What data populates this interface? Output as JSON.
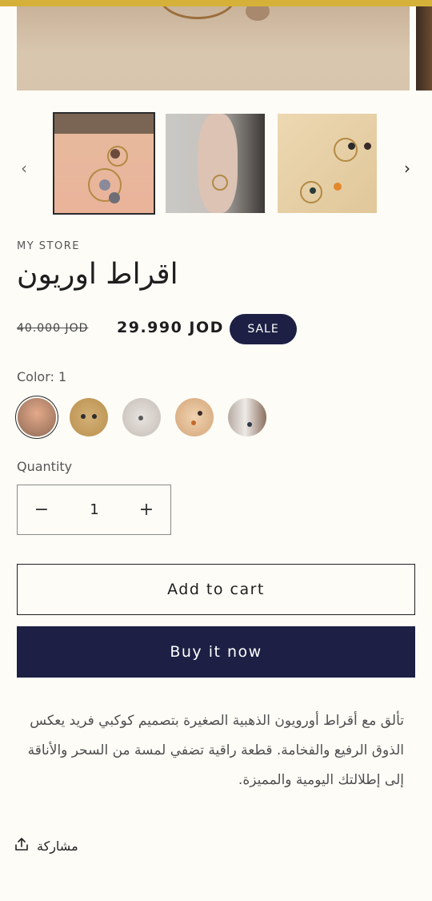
{
  "gallery": {
    "prev_icon": "chevron-left-icon",
    "next_icon": "chevron-right-icon",
    "prev_glyph": "‹",
    "next_glyph": "›",
    "thumbnails": [
      {
        "selected": true
      },
      {
        "selected": false
      },
      {
        "selected": false
      }
    ]
  },
  "product": {
    "vendor": "MY STORE",
    "title": "اقراط اوريون",
    "compare_price": "40.000 JOD",
    "price": "29.990 JOD",
    "sale_badge": "SALE",
    "color_label": "Color: 1",
    "swatches": [
      {
        "selected": true
      },
      {
        "selected": false
      },
      {
        "selected": false
      },
      {
        "selected": false
      },
      {
        "selected": false
      }
    ],
    "quantity_label": "Quantity",
    "quantity_value": "1",
    "minus_glyph": "−",
    "plus_glyph": "+",
    "add_to_cart": "Add to cart",
    "buy_now": "Buy it now",
    "description": "تألق مع أقراط أورويون الذهبية الصغيرة بتصميم كوكبي فريد يعكس الذوق الرفيع والفخامة. قطعة راقية تضفي لمسة من السحر والأناقة إلى إطلالتك اليومية والمميزة.",
    "share_label": "مشاركة",
    "share_icon": "share-icon"
  },
  "colors": {
    "accent_bar": "#d6b13a",
    "button_dark": "#1d2044",
    "background": "#fdfcf7"
  }
}
